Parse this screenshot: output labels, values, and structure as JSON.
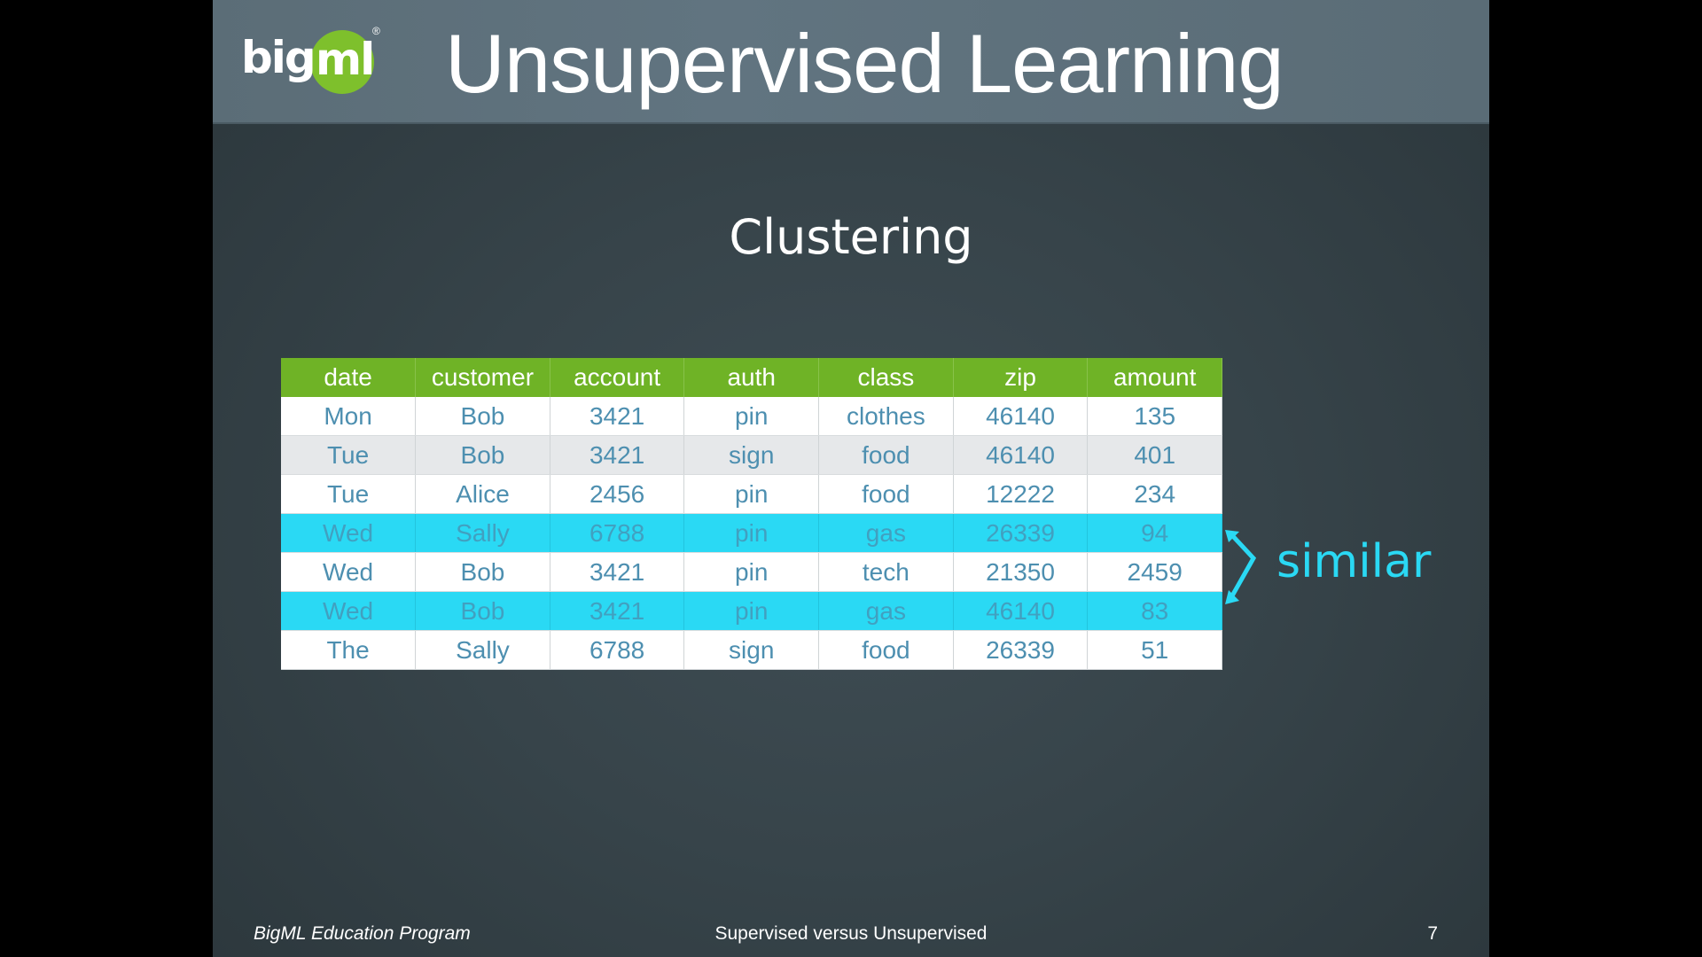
{
  "header": {
    "logo_text_big": "big",
    "logo_text_ml": "ml",
    "logo_reg": "®",
    "title": "Unsupervised Learning"
  },
  "subtitle": "Clustering",
  "table": {
    "columns": [
      "date",
      "customer",
      "account",
      "auth",
      "class",
      "zip",
      "amount"
    ],
    "rows": [
      {
        "style": "white",
        "cells": [
          "Mon",
          "Bob",
          "3421",
          "pin",
          "clothes",
          "46140",
          "135"
        ]
      },
      {
        "style": "grey",
        "cells": [
          "Tue",
          "Bob",
          "3421",
          "sign",
          "food",
          "46140",
          "401"
        ]
      },
      {
        "style": "white",
        "cells": [
          "Tue",
          "Alice",
          "2456",
          "pin",
          "food",
          "12222",
          "234"
        ]
      },
      {
        "style": "highlight",
        "cells": [
          "Wed",
          "Sally",
          "6788",
          "pin",
          "gas",
          "26339",
          "94"
        ]
      },
      {
        "style": "white",
        "cells": [
          "Wed",
          "Bob",
          "3421",
          "pin",
          "tech",
          "21350",
          "2459"
        ]
      },
      {
        "style": "highlight",
        "cells": [
          "Wed",
          "Bob",
          "3421",
          "pin",
          "gas",
          "46140",
          "83"
        ]
      },
      {
        "style": "white",
        "cells": [
          "The",
          "Sally",
          "6788",
          "sign",
          "food",
          "26339",
          "51"
        ]
      }
    ]
  },
  "annotation": {
    "label": "similar",
    "color": "#2ad9f4"
  },
  "footer": {
    "left": "BigML Education Program",
    "center": "Supervised versus Unsupervised",
    "page_number": "7"
  },
  "colors": {
    "header_green": "#6fb326",
    "highlight_cyan": "#2ad9f4",
    "logo_green": "#7ec02c"
  }
}
